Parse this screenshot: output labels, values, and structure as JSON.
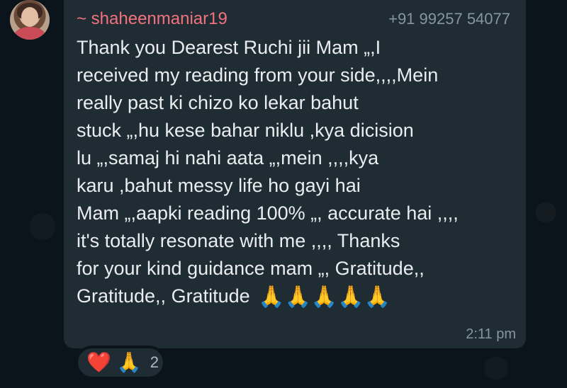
{
  "sender": {
    "name": "~ shaheenmaniar19",
    "phone": "+91 99257 54077"
  },
  "message": {
    "lines": [
      "Thank you Dearest Ruchi jii Mam „,I",
      "received my reading from your side,,,,Mein",
      "really past ki chizo ko lekar bahut",
      "stuck „,hu kese bahar niklu ,kya dicision",
      "lu „,samaj hi nahi aata „,mein ,,,,kya",
      "karu ,bahut messy life ho gayi hai",
      "Mam „,aapki reading 100% „, accurate hai ,,,,",
      "it's totally resonate with me ,,,, Thanks",
      "for your kind guidance mam „, Gratitude,,",
      "Gratitude,, Gratitude"
    ],
    "emoji_trail": "🙏🙏🙏🙏🙏",
    "time": "2:11 pm"
  },
  "reactions": {
    "heart": "❤️",
    "pray": "🙏",
    "count": "2"
  }
}
